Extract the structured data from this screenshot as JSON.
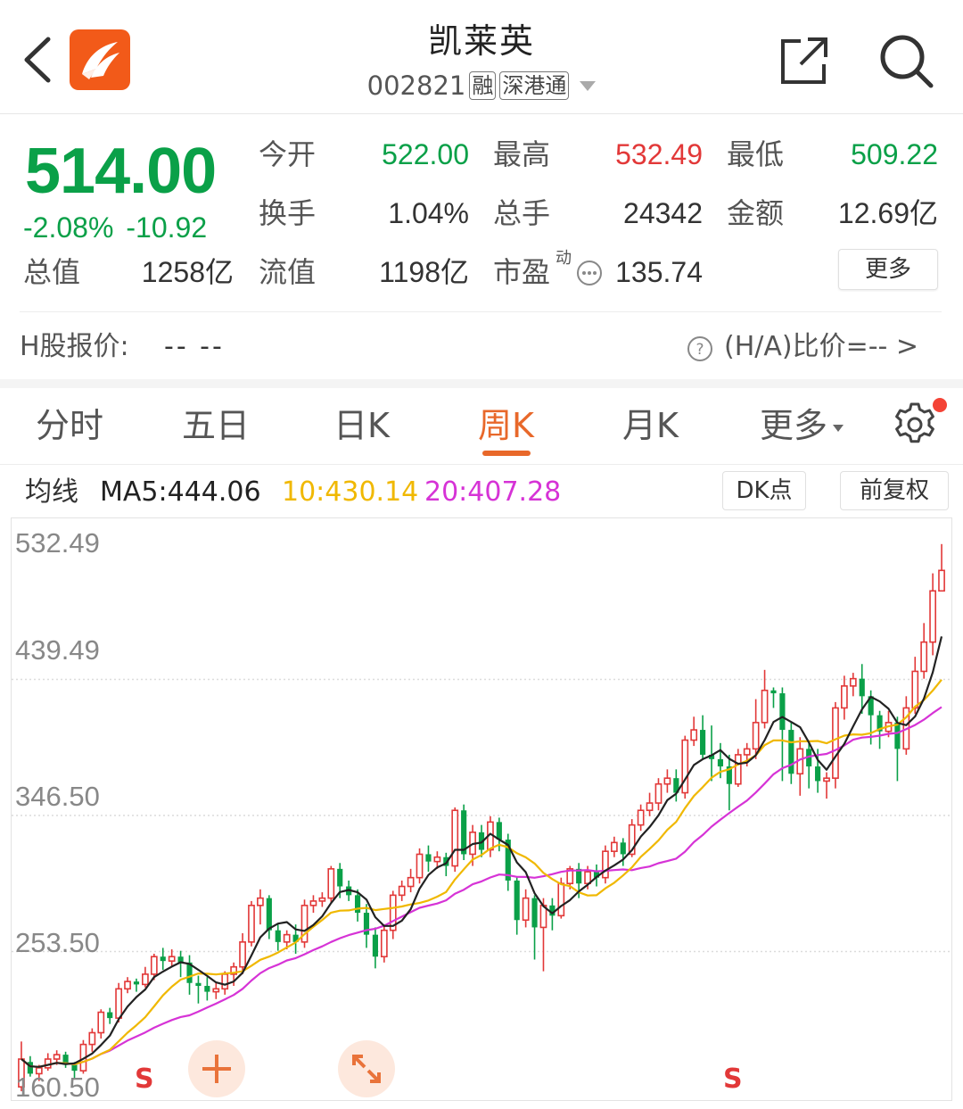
{
  "header": {
    "stock_name": "凯莱英",
    "stock_code": "002821",
    "tags": [
      "融",
      "深港通"
    ]
  },
  "quote": {
    "price": "514.00",
    "change_pct": "-2.08%",
    "change_amt": "-10.92",
    "stats": [
      {
        "label": "今开",
        "value": "522.00",
        "color": "green"
      },
      {
        "label": "最高",
        "value": "532.49",
        "color": "red"
      },
      {
        "label": "最低",
        "value": "509.22",
        "color": "green"
      },
      {
        "label": "换手",
        "value": "1.04%",
        "color": "neutral"
      },
      {
        "label": "总手",
        "value": "24342",
        "color": "neutral"
      },
      {
        "label": "金额",
        "value": "12.69亿",
        "color": "neutral"
      },
      {
        "label": "总值",
        "value": "1258亿",
        "color": "neutral"
      },
      {
        "label": "流值",
        "value": "1198亿",
        "color": "neutral"
      },
      {
        "label": "市盈",
        "value": "135.74",
        "color": "neutral"
      }
    ],
    "pe_superscript": "动",
    "more_label": "更多",
    "h_share_label": "H股报价:",
    "h_share_value": "--  --",
    "ha_ratio": "(H/A)比价=-- >"
  },
  "tabs": [
    {
      "label": "分时",
      "active": false
    },
    {
      "label": "五日",
      "active": false
    },
    {
      "label": "日K",
      "active": false
    },
    {
      "label": "周K",
      "active": true
    },
    {
      "label": "月K",
      "active": false
    },
    {
      "label": "更多",
      "active": false
    }
  ],
  "indicators": {
    "label": "均线",
    "ma5": "MA5:444.06",
    "ma10": "10:430.14",
    "ma20": "20:407.28",
    "ma5_color": "#222222",
    "ma10_color": "#f0b800",
    "ma20_color": "#d633d6",
    "dk_button": "DK点",
    "adjust_button": "前复权"
  },
  "colors": {
    "up": "#e23838",
    "down": "#0aa048",
    "accent": "#e8682a"
  },
  "chart_data": {
    "type": "candlestick",
    "y_ticks": [
      "532.49",
      "439.49",
      "346.50",
      "253.50",
      "160.50"
    ],
    "ylim": [
      160.5,
      532.49
    ],
    "markers": [
      "S",
      "S"
    ],
    "candles": [
      [
        161,
        180,
        192,
        158
      ],
      [
        178,
        170,
        182,
        168
      ],
      [
        170,
        174,
        176,
        165
      ],
      [
        174,
        180,
        184,
        172
      ],
      [
        180,
        183,
        186,
        176
      ],
      [
        183,
        176,
        185,
        174
      ],
      [
        176,
        172,
        178,
        166
      ],
      [
        172,
        190,
        193,
        170
      ],
      [
        190,
        198,
        201,
        185
      ],
      [
        198,
        212,
        214,
        194
      ],
      [
        212,
        208,
        215,
        204
      ],
      [
        208,
        228,
        232,
        205
      ],
      [
        228,
        233,
        236,
        225
      ],
      [
        233,
        231,
        235,
        226
      ],
      [
        231,
        238,
        243,
        229
      ],
      [
        238,
        250,
        252,
        234
      ],
      [
        250,
        247,
        256,
        241
      ],
      [
        247,
        250,
        255,
        243
      ],
      [
        250,
        246,
        254,
        236
      ],
      [
        246,
        232,
        251,
        224
      ],
      [
        232,
        230,
        237,
        218
      ],
      [
        230,
        226,
        236,
        220
      ],
      [
        226,
        228,
        232,
        221
      ],
      [
        228,
        238,
        240,
        224
      ],
      [
        238,
        243,
        246,
        230
      ],
      [
        243,
        260,
        266,
        238
      ],
      [
        260,
        285,
        288,
        257
      ],
      [
        285,
        290,
        296,
        272
      ],
      [
        290,
        268,
        292,
        262
      ],
      [
        268,
        260,
        272,
        254
      ],
      [
        260,
        265,
        268,
        255
      ],
      [
        265,
        260,
        272,
        252
      ],
      [
        260,
        285,
        289,
        256
      ],
      [
        285,
        288,
        292,
        280
      ],
      [
        288,
        290,
        294,
        284
      ],
      [
        290,
        310,
        312,
        287
      ],
      [
        310,
        298,
        314,
        290
      ],
      [
        298,
        292,
        302,
        288
      ],
      [
        292,
        280,
        296,
        274
      ],
      [
        280,
        265,
        286,
        256
      ],
      [
        265,
        250,
        270,
        242
      ],
      [
        250,
        268,
        272,
        246
      ],
      [
        268,
        292,
        295,
        262
      ],
      [
        292,
        298,
        302,
        288
      ],
      [
        298,
        304,
        310,
        294
      ],
      [
        304,
        320,
        324,
        300
      ],
      [
        320,
        315,
        326,
        308
      ],
      [
        315,
        318,
        322,
        310
      ],
      [
        318,
        312,
        321,
        305
      ],
      [
        312,
        350,
        352,
        308
      ],
      [
        350,
        320,
        354,
        316
      ],
      [
        320,
        335,
        340,
        312
      ],
      [
        335,
        323,
        340,
        318
      ],
      [
        323,
        342,
        346,
        318
      ],
      [
        342,
        330,
        345,
        322
      ],
      [
        330,
        302,
        334,
        295
      ],
      [
        302,
        275,
        305,
        265
      ],
      [
        275,
        290,
        296,
        270
      ],
      [
        290,
        270,
        292,
        248
      ],
      [
        270,
        285,
        290,
        240
      ],
      [
        285,
        278,
        290,
        268
      ],
      [
        278,
        300,
        304,
        276
      ],
      [
        300,
        310,
        312,
        296
      ],
      [
        310,
        300,
        314,
        290
      ],
      [
        300,
        308,
        312,
        296
      ],
      [
        308,
        304,
        313,
        298
      ],
      [
        304,
        322,
        326,
        300
      ],
      [
        322,
        328,
        332,
        318
      ],
      [
        328,
        320,
        331,
        312
      ],
      [
        320,
        340,
        344,
        318
      ],
      [
        340,
        350,
        354,
        336
      ],
      [
        350,
        355,
        362,
        346
      ],
      [
        355,
        368,
        372,
        350
      ],
      [
        368,
        372,
        378,
        362
      ],
      [
        372,
        362,
        378,
        356
      ],
      [
        362,
        398,
        401,
        358
      ],
      [
        398,
        405,
        414,
        394
      ],
      [
        405,
        388,
        415,
        385
      ],
      [
        388,
        385,
        408,
        370
      ],
      [
        385,
        380,
        396,
        372
      ],
      [
        380,
        368,
        388,
        350
      ],
      [
        368,
        388,
        392,
        366
      ],
      [
        388,
        392,
        396,
        380
      ],
      [
        392,
        410,
        426,
        385
      ],
      [
        410,
        432,
        446,
        406
      ],
      [
        432,
        430,
        434,
        420
      ],
      [
        430,
        405,
        434,
        370
      ],
      [
        405,
        375,
        410,
        368
      ],
      [
        375,
        392,
        400,
        360
      ],
      [
        392,
        380,
        396,
        365
      ],
      [
        380,
        370,
        392,
        362
      ],
      [
        370,
        372,
        376,
        358
      ],
      [
        372,
        420,
        424,
        365
      ],
      [
        420,
        435,
        442,
        412
      ],
      [
        435,
        440,
        444,
        428
      ],
      [
        440,
        428,
        450,
        416
      ],
      [
        428,
        415,
        432,
        395
      ],
      [
        415,
        404,
        418,
        392
      ],
      [
        404,
        410,
        418,
        400
      ],
      [
        410,
        392,
        414,
        370
      ],
      [
        392,
        420,
        428,
        388
      ],
      [
        420,
        445,
        455,
        416
      ],
      [
        445,
        465,
        478,
        440
      ],
      [
        465,
        500,
        512,
        456
      ],
      [
        500,
        514,
        532,
        508
      ]
    ]
  }
}
